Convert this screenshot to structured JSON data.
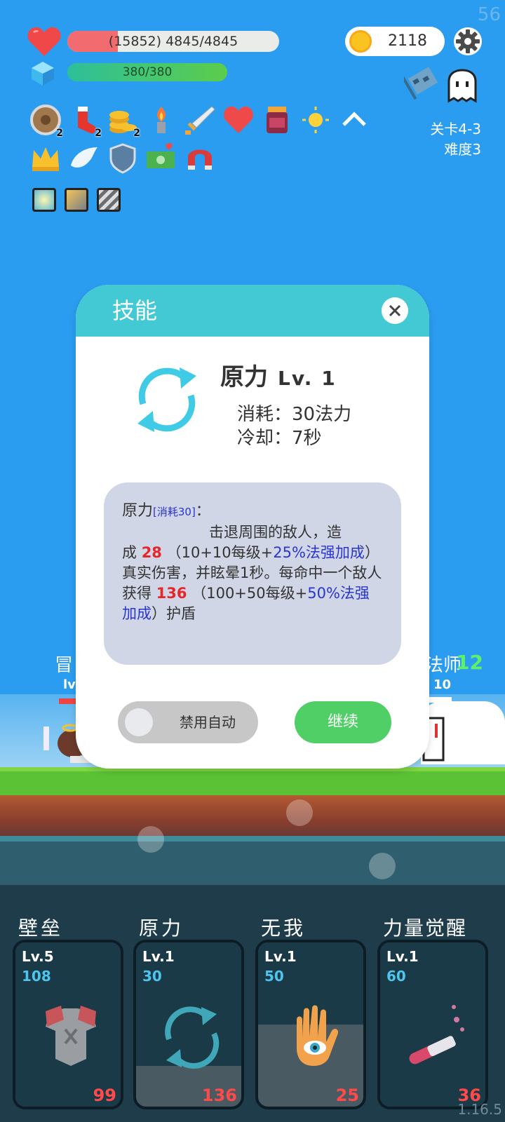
{
  "fps": "56",
  "player": {
    "hp_text": "(15852) 4845/4845",
    "hp_fill_fraction": 0.24,
    "mp_text": "380/380",
    "mp_fill_fraction": 1.0
  },
  "gold": "2118",
  "stage": {
    "level": "关卡4-3",
    "difficulty": "难度3"
  },
  "buffs_row1": [
    {
      "icon": "shield-wood-icon",
      "count": "2"
    },
    {
      "icon": "sock-icon",
      "count": "2"
    },
    {
      "icon": "coins-icon",
      "count": "2"
    },
    {
      "icon": "torch-icon",
      "count": ""
    },
    {
      "icon": "sword-icon",
      "count": ""
    },
    {
      "icon": "heart-icon",
      "count": ""
    },
    {
      "icon": "jam-jar-icon",
      "count": ""
    },
    {
      "icon": "sun-icon",
      "count": ""
    }
  ],
  "buffs_row2": [
    {
      "icon": "crown-icon"
    },
    {
      "icon": "wing-icon"
    },
    {
      "icon": "shield-icon"
    },
    {
      "icon": "cash-icon"
    },
    {
      "icon": "magnet-icon"
    }
  ],
  "chips": [
    "light-chip-icon",
    "armor-chip-icon",
    "blade-chip-icon"
  ],
  "scene": {
    "left_name": "冒",
    "left_level": "lv",
    "right_name": "法师",
    "right_num": "12",
    "right_level": "10"
  },
  "dialog": {
    "title": "技能",
    "skill_name": "原力",
    "skill_level": "Lv. 1",
    "cost": "消耗：30法力",
    "cooldown": "冷却：7秒",
    "desc": {
      "name": "原力",
      "tag": "[消耗30]",
      "colon": "：",
      "line1": "击退周围的敌人，造",
      "p1": "成",
      "dmg": "28",
      "p2": "（10+10每级+",
      "dmg_bonus": "25%法强加成",
      "p3": "）真实伤害，并眩晕1秒。每命中一个敌人获得",
      "shield": "136",
      "p4": "（100+50每级+",
      "shield_bonus": "50%法强加成",
      "p5": "）护盾"
    },
    "toggle_label": "禁用自动",
    "continue_label": "继续"
  },
  "skills": [
    {
      "name": "壁垒",
      "level": "Lv.5",
      "mp": "108",
      "value": "99",
      "icon": "armor-icon",
      "cooldown_fraction": 1.0
    },
    {
      "name": "原力",
      "level": "Lv.1",
      "mp": "30",
      "value": "136",
      "icon": "force-cycle-icon",
      "cooldown_fraction": 0.75
    },
    {
      "name": "无我",
      "level": "Lv.1",
      "mp": "50",
      "value": "25",
      "icon": "hand-eye-icon",
      "cooldown_fraction": 0.5
    },
    {
      "name": "力量觉醒",
      "level": "Lv.1",
      "mp": "60",
      "value": "36",
      "icon": "potion-icon",
      "cooldown_fraction": 1.0
    }
  ],
  "version": "1.16.5",
  "colors": {
    "sky": "#2b9df0",
    "dialog_header": "#43c9d4",
    "continue": "#4fcf65",
    "damage_red": "#e5262b",
    "bonus_blue": "#2a35d0"
  }
}
